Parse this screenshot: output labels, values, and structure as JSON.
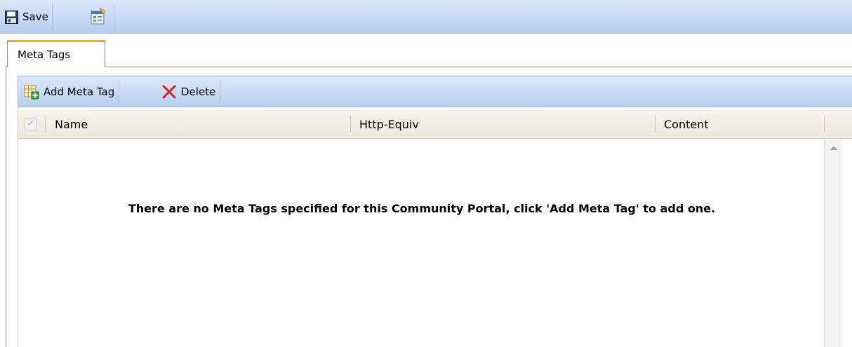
{
  "toolbar": {
    "save_label": "Save",
    "save_icon": "floppy-disk-icon",
    "settings_icon": "page-settings-icon"
  },
  "tabs": [
    {
      "label": "Meta Tags",
      "active": true
    }
  ],
  "grid_toolbar": {
    "add_label": "Add Meta Tag",
    "add_icon": "add-table-icon",
    "delete_label": "Delete",
    "delete_icon": "red-x-icon"
  },
  "grid": {
    "columns": [
      "Name",
      "Http-Equiv",
      "Content"
    ],
    "empty_message": "There are no Meta Tags specified for this Community Portal, click 'Add Meta Tag' to add one.",
    "header_check": "✓"
  },
  "colors": {
    "toolbar_blue": "#c6d9f5",
    "tab_accent": "#f2b100",
    "delete_red": "#d42020"
  }
}
